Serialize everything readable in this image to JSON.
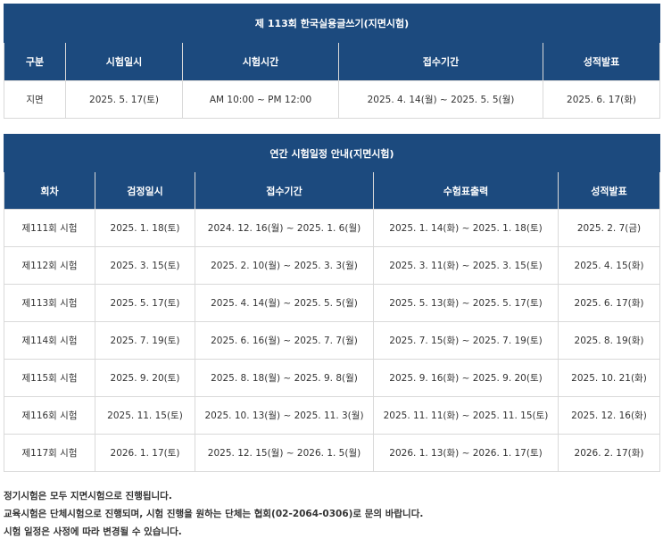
{
  "exam_table": {
    "title": "제 113회 한국실용글쓰기(지면시험)",
    "headers": [
      "구분",
      "시험일시",
      "시험시간",
      "접수기간",
      "성적발표"
    ],
    "row": [
      "지면",
      "2025. 5. 17(토)",
      "AM 10:00 ~ PM 12:00",
      "2025. 4. 14(월) ~ 2025. 5. 5(월)",
      "2025. 6. 17(화)"
    ]
  },
  "schedule_table": {
    "title": "연간 시험일정 안내(지면시험)",
    "headers": [
      "회차",
      "검정일시",
      "접수기간",
      "수험표출력",
      "성적발표"
    ],
    "rows": [
      [
        "제111회 시험",
        "2025. 1. 18(토)",
        "2024. 12. 16(월) ~ 2025. 1. 6(월)",
        "2025. 1. 14(화) ~ 2025. 1. 18(토)",
        "2025. 2. 7(금)"
      ],
      [
        "제112회 시험",
        "2025. 3. 15(토)",
        "2025. 2. 10(월) ~ 2025. 3. 3(월)",
        "2025. 3. 11(화) ~ 2025. 3. 15(토)",
        "2025. 4. 15(화)"
      ],
      [
        "제113회 시험",
        "2025. 5. 17(토)",
        "2025. 4. 14(월) ~ 2025. 5. 5(월)",
        "2025. 5. 13(화) ~ 2025. 5. 17(토)",
        "2025. 6. 17(화)"
      ],
      [
        "제114회 시험",
        "2025. 7. 19(토)",
        "2025. 6. 16(월) ~ 2025. 7. 7(월)",
        "2025. 7. 15(화) ~ 2025. 7. 19(토)",
        "2025. 8. 19(화)"
      ],
      [
        "제115회 시험",
        "2025. 9. 20(토)",
        "2025. 8. 18(월) ~ 2025. 9. 8(월)",
        "2025. 9. 16(화) ~ 2025. 9. 20(토)",
        "2025. 10. 21(화)"
      ],
      [
        "제116회 시험",
        "2025. 11. 15(토)",
        "2025. 10. 13(월) ~ 2025. 11. 3(월)",
        "2025. 11. 11(화) ~ 2025. 11. 15(토)",
        "2025. 12. 16(화)"
      ],
      [
        "제117회 시험",
        "2026. 1. 17(토)",
        "2025. 12. 15(월) ~ 2026. 1. 5(월)",
        "2026. 1. 13(화) ~ 2026. 1. 17(토)",
        "2026. 2. 17(화)"
      ]
    ]
  },
  "notes": [
    "정기시험은 모두 지면시험으로 진행됩니다.",
    "교육시험은 단체시험으로 진행되며, 시험 진행을 원하는 단체는 협회(02-2064-0306)로 문의 바랍니다.",
    "시험 일정은 사정에 따라 변경될 수 있습니다."
  ]
}
